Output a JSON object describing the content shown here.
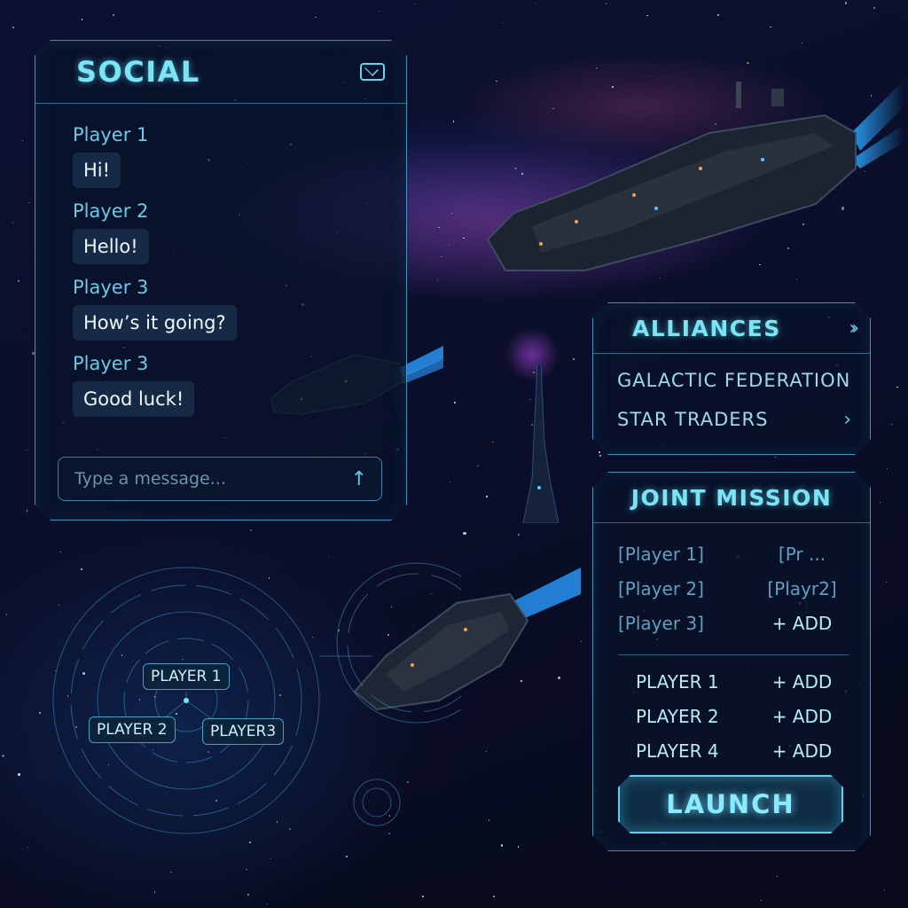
{
  "social": {
    "title": "SOCIAL",
    "icon": "mail-icon",
    "messages": [
      {
        "sender": "Player 1",
        "text": "Hi!"
      },
      {
        "sender": "Player 2",
        "text": "Hello!"
      },
      {
        "sender": "Player 3",
        "text": "How’s it going?"
      },
      {
        "sender": "Player 3",
        "text": "Good luck!"
      }
    ],
    "input_placeholder": "Type a message...",
    "send_icon": "arrow-up-icon"
  },
  "alliances": {
    "title": "ALLIANCES",
    "items": [
      "GALACTIC FEDERATION",
      "STAR TRADERS"
    ]
  },
  "joint_mission": {
    "title": "JOINT MISSION",
    "slots": [
      {
        "left": "[Player 1]",
        "right": "[Pr ..."
      },
      {
        "left": "[Player 2]",
        "right": "[Playr2]"
      },
      {
        "left": "[Player 3]",
        "right": "+ ADD"
      }
    ],
    "roster": [
      {
        "name": "PLAYER 1",
        "action": "+ ADD"
      },
      {
        "name": "PLAYER 2",
        "action": "+ ADD"
      },
      {
        "name": "PLAYER 4",
        "action": "+ ADD"
      }
    ],
    "launch_label": "LAUNCH"
  },
  "radar": {
    "tags": [
      "PLAYER 1",
      "PLAYER 2",
      "PLAYER3"
    ]
  },
  "colors": {
    "accent": "#7be4f5",
    "panel_border": "#56bee6",
    "background": "#070b1f"
  }
}
